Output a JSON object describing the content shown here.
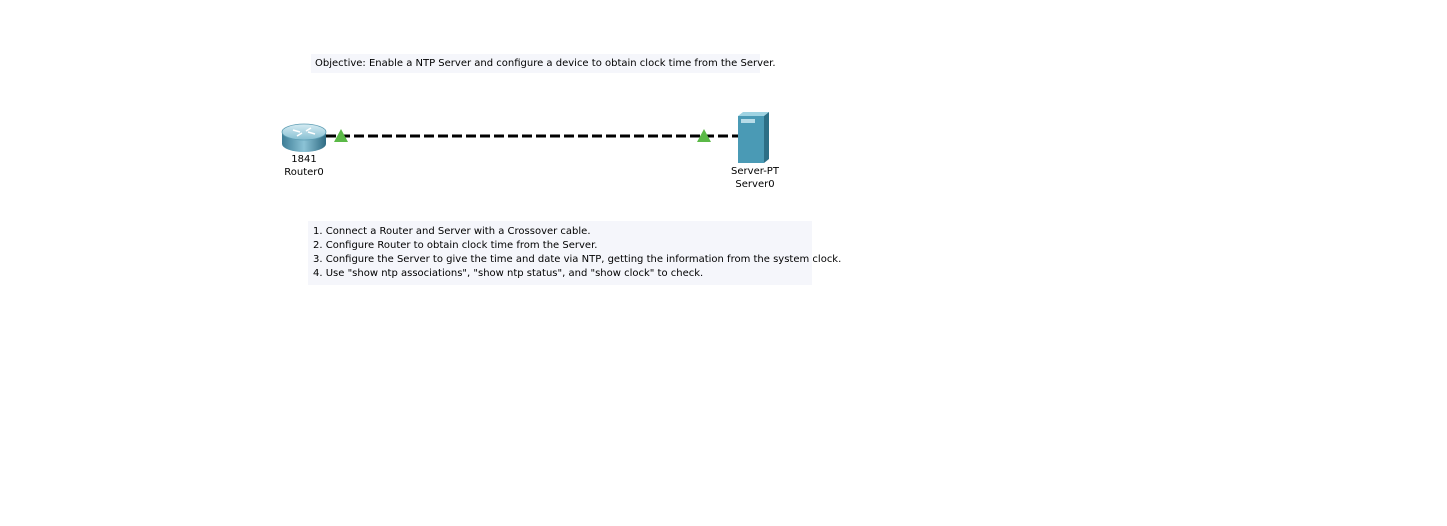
{
  "notes": {
    "objective": "Objective: Enable a NTP Server and configure a device to obtain clock time from the Server.",
    "steps": [
      "1. Connect a Router and Server with a Crossover cable.",
      "2. Configure Router to obtain clock time from the Server.",
      "3. Configure the Server to give the time and date via NTP, getting the information from the system clock.",
      "4. Use \"show ntp associations\", \"show ntp status\", and \"show clock\" to check."
    ]
  },
  "devices": {
    "router": {
      "model": "1841",
      "name": "Router0",
      "icon": "router-icon"
    },
    "server": {
      "model": "Server-PT",
      "name": "Server0",
      "icon": "server-icon"
    }
  },
  "link": {
    "cable_type": "crossover",
    "status": "up",
    "colors": {
      "cable": "#000000",
      "link_up": "#5bb947"
    }
  }
}
